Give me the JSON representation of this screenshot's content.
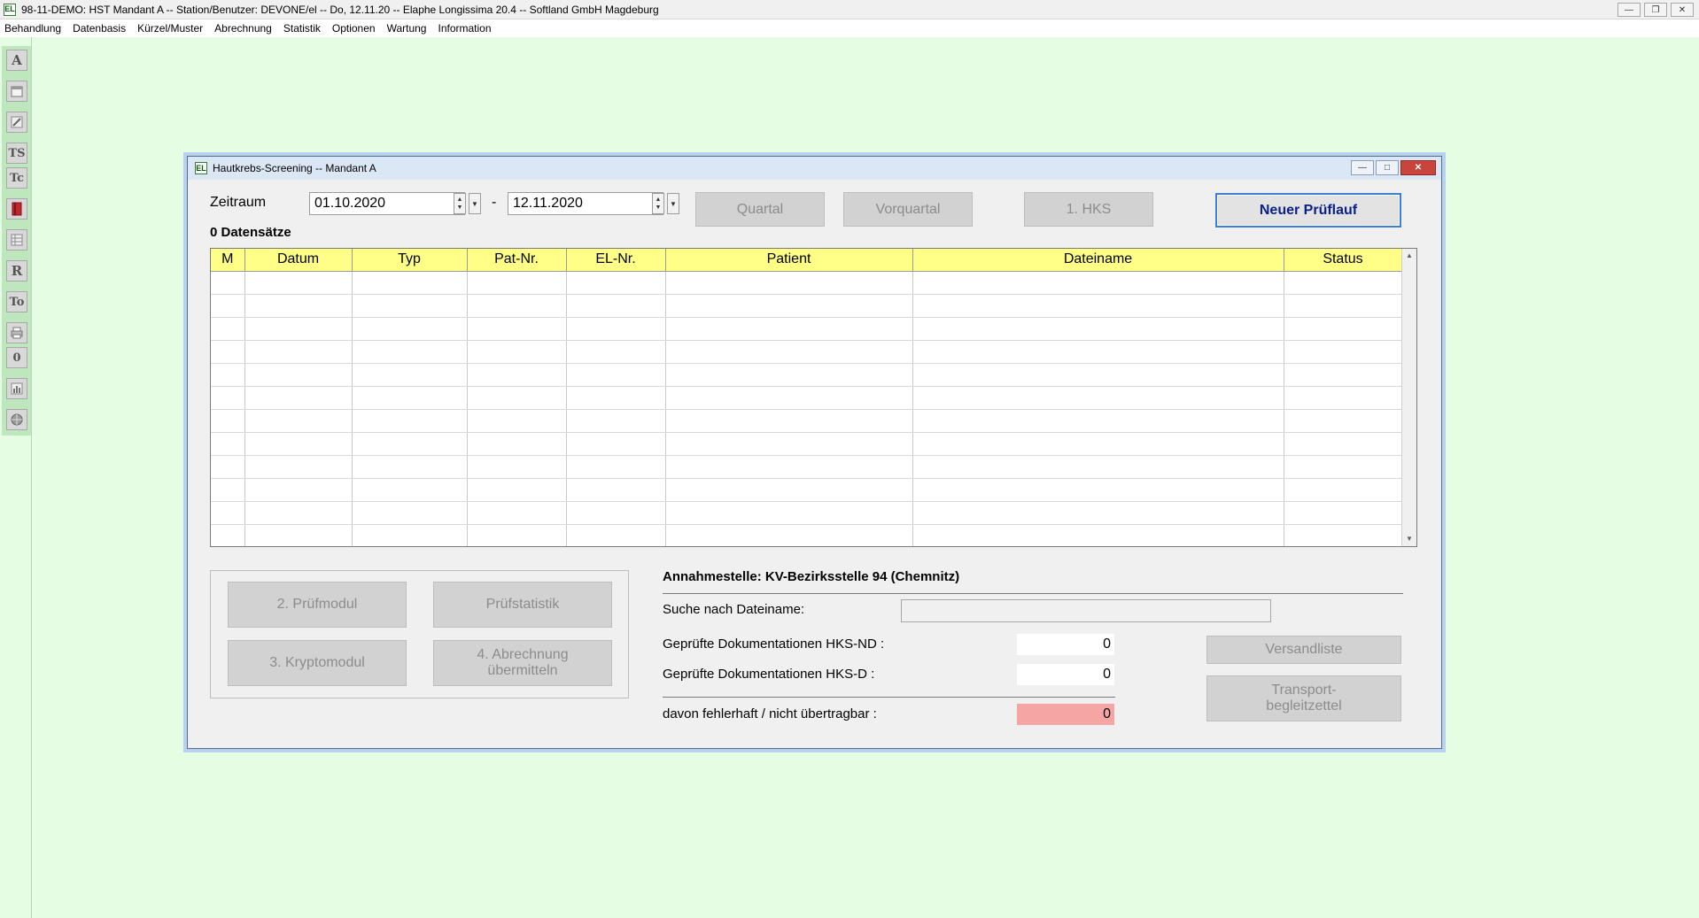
{
  "app": {
    "title": "98-11-DEMO: HST Mandant A -- Station/Benutzer: DEVONE/el -- Do, 12.11.20 -- Elaphe Longissima 20.4 -- Softland GmbH Magdeburg",
    "logo_text": "EL"
  },
  "menu": [
    "Behandlung",
    "Datenbasis",
    "Kürzel/Muster",
    "Abrechnung",
    "Statistik",
    "Optionen",
    "Wartung",
    "Information"
  ],
  "toolbar": {
    "a": "A",
    "ts": "TS",
    "tc": "Tc",
    "r": "R",
    "to": "To",
    "zero": "0",
    "icons": [
      "calendar-icon",
      "pen-icon",
      "book-red-icon",
      "table-icon",
      "printer-icon",
      "report-icon",
      "globe-icon"
    ]
  },
  "dialog": {
    "title": "Hautkrebs-Screening -- Mandant A",
    "zeitraum_label": "Zeitraum",
    "date_from": "01.10.2020",
    "date_sep": "-",
    "date_to": "12.11.2020",
    "count_label": "0 Datensätze",
    "buttons": {
      "quartal": "Quartal",
      "vorquartal": "Vorquartal",
      "hks": "1. HKS",
      "neuer": "Neuer Prüflauf",
      "pruefmodul": "2. Prüfmodul",
      "pruefstatistik": "Prüfstatistik",
      "kryptomodul": "3. Kryptomodul",
      "abrechnung": "4. Abrechnung übermitteln",
      "versandliste": "Versandliste",
      "transport": "Transport- begleitzettel"
    },
    "table": {
      "columns": [
        "M",
        "Datum",
        "Typ",
        "Pat-Nr.",
        "EL-Nr.",
        "Patient",
        "Dateiname",
        "Status"
      ],
      "rows": []
    },
    "annahmestelle": "Annahmestelle: KV-Bezirksstelle 94 (Chemnitz)",
    "search_label": "Suche nach Dateiname:",
    "search_value": "",
    "nd_label": "Geprüfte Dokumentationen HKS-ND :",
    "nd_value": "0",
    "d_label": "Geprüfte Dokumentationen HKS-D :",
    "d_value": "0",
    "err_label": "davon fehlerhaft / nicht übertragbar :",
    "err_value": "0"
  }
}
